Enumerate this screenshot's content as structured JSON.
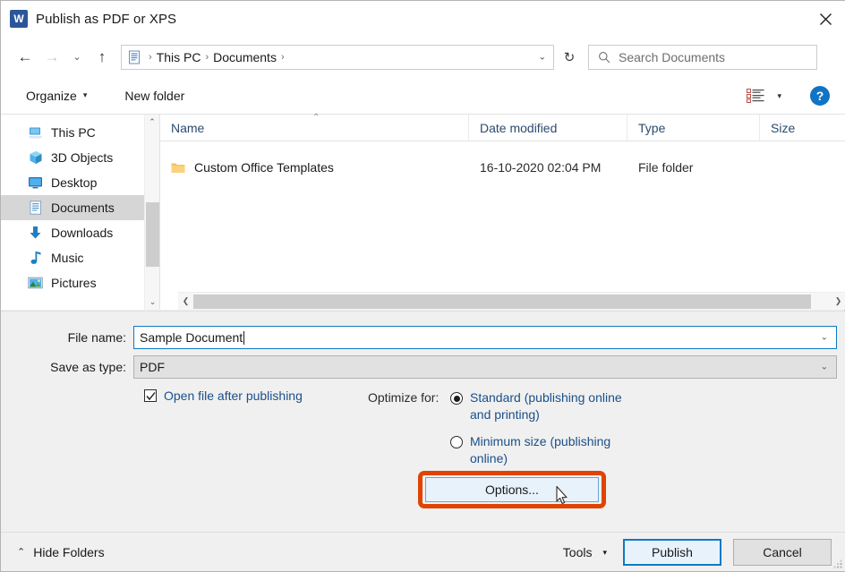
{
  "window": {
    "title": "Publish as PDF or XPS",
    "app_icon": "word-icon",
    "close_label": "✕"
  },
  "nav": {
    "back_icon": "back-arrow-icon",
    "forward_icon": "forward-arrow-icon",
    "recent_icon": "chevron-down-icon",
    "up_icon": "up-arrow-icon",
    "breadcrumb": [
      {
        "label": "This PC"
      },
      {
        "label": "Documents"
      }
    ],
    "breadcrumb_separator": "›",
    "dropdown_icon": "chevron-down-icon",
    "refresh_icon": "refresh-icon",
    "refresh_glyph": "↻"
  },
  "search": {
    "placeholder": "Search Documents",
    "icon": "search-icon"
  },
  "toolbar": {
    "organize_label": "Organize",
    "organize_caret": "▾",
    "new_folder_label": "New folder",
    "view_icon": "view-layout-icon",
    "view_caret": "▾",
    "help_label": "?"
  },
  "sidebar": {
    "items": [
      {
        "label": "This PC",
        "icon": "this-pc-icon",
        "selected": false
      },
      {
        "label": "3D Objects",
        "icon": "3d-objects-icon",
        "selected": false
      },
      {
        "label": "Desktop",
        "icon": "desktop-icon",
        "selected": false
      },
      {
        "label": "Documents",
        "icon": "documents-icon",
        "selected": true
      },
      {
        "label": "Downloads",
        "icon": "downloads-icon",
        "selected": false
      },
      {
        "label": "Music",
        "icon": "music-icon",
        "selected": false
      },
      {
        "label": "Pictures",
        "icon": "pictures-icon",
        "selected": false
      }
    ],
    "scroll_up_icon": "chevron-up-icon",
    "scroll_down_icon": "chevron-down-icon"
  },
  "filelist": {
    "columns": [
      {
        "label": "Name",
        "sorted": true,
        "sort_caret": "⌃"
      },
      {
        "label": "Date modified",
        "sorted": false
      },
      {
        "label": "Type",
        "sorted": false
      },
      {
        "label": "Size",
        "sorted": false
      }
    ],
    "rows": [
      {
        "name": "Custom Office Templates",
        "date_modified": "16-10-2020 02:04 PM",
        "type": "File folder",
        "size": "",
        "icon": "folder-icon"
      }
    ],
    "hscroll_left_icon": "chevron-left-icon",
    "hscroll_right_icon": "chevron-right-icon"
  },
  "form": {
    "file_name_label": "File name:",
    "file_name_value": "Sample Document",
    "file_name_caret": "chevron-down-icon",
    "save_as_type_label": "Save as type:",
    "save_as_type_value": "PDF",
    "save_as_type_caret": "chevron-down-icon",
    "open_after_publishing_label": "Open file after publishing",
    "open_after_publishing_checked": true,
    "check_glyph": "✓",
    "optimize_for_label": "Optimize for:",
    "radio_options": [
      {
        "label": "Standard (publishing online and printing)",
        "selected": true
      },
      {
        "label": "Minimum size (publishing online)",
        "selected": false
      }
    ],
    "options_button_label": "Options...",
    "annotation_color": "#e04403",
    "accent_color": "#0d7ac4",
    "link_color": "#1a4f8a"
  },
  "footer": {
    "hide_folders_label": "Hide Folders",
    "hide_folders_chevron": "⌃",
    "tools_label": "Tools",
    "tools_caret": "▾",
    "publish_label": "Publish",
    "cancel_label": "Cancel"
  }
}
